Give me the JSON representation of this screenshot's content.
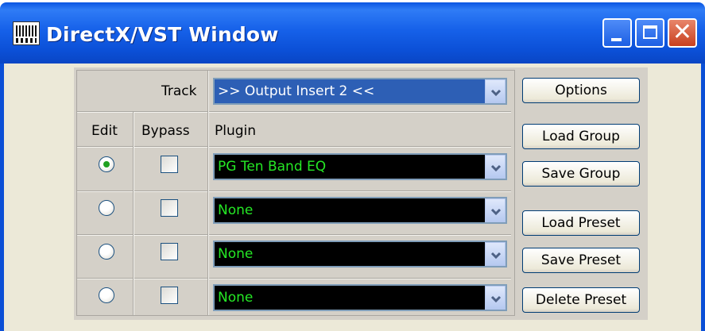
{
  "window": {
    "title": "DirectX/VST Window"
  },
  "track": {
    "label": "Track",
    "value": ">> Output Insert 2 <<"
  },
  "columns": {
    "edit": "Edit",
    "bypass": "Bypass",
    "plugin": "Plugin"
  },
  "rows": [
    {
      "edit_selected": true,
      "bypass": false,
      "plugin": "PG Ten Band EQ"
    },
    {
      "edit_selected": false,
      "bypass": false,
      "plugin": "None"
    },
    {
      "edit_selected": false,
      "bypass": false,
      "plugin": "None"
    },
    {
      "edit_selected": false,
      "bypass": false,
      "plugin": "None"
    }
  ],
  "buttons": {
    "options": "Options",
    "load_group": "Load Group",
    "save_group": "Save Group",
    "load_preset": "Load Preset",
    "save_preset": "Save Preset",
    "delete_preset": "Delete Preset"
  },
  "icons": {
    "app": "app-icon",
    "minimize": "minimize-icon",
    "maximize": "maximize-icon",
    "close": "close-icon",
    "dropdown": "chevron-down-icon"
  },
  "colors": {
    "titlebar": "#0b4fd6",
    "plugin_text": "#25e825",
    "plugin_bg": "#000000",
    "track_bg": "#2d5fb5",
    "panel": "#d4d0c8"
  }
}
